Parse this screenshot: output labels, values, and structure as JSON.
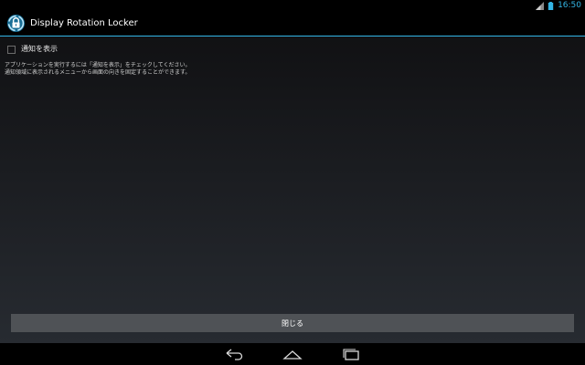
{
  "status_bar": {
    "time": "16:50",
    "icons": [
      "signal-icon",
      "battery-icon"
    ]
  },
  "app": {
    "title": "Display Rotation Locker",
    "icon": "lock-rotation-icon",
    "accent_color": "#33b5e5"
  },
  "settings": {
    "show_notification_label": "通知を表示",
    "show_notification_checked": false,
    "description_line1": "アプリケーションを実行するには「通知を表示」をチェックしてください。",
    "description_line2": "通知領域に表示されるメニューから画面の向きを固定することができます。"
  },
  "footer": {
    "close_label": "閉じる"
  },
  "nav": {
    "icons": [
      "back-icon",
      "home-icon",
      "recent-apps-icon"
    ]
  }
}
